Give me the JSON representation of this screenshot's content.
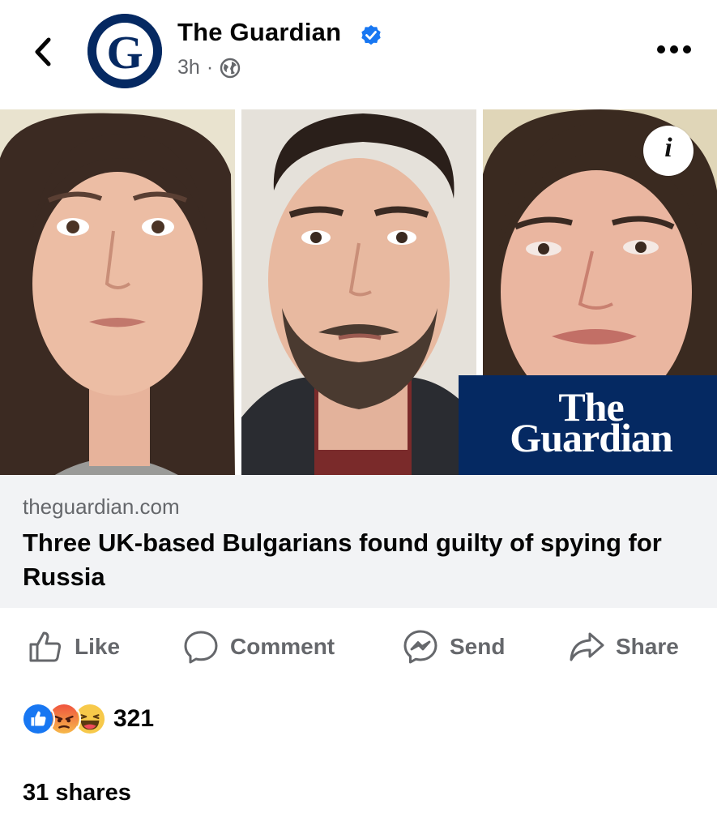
{
  "post": {
    "page_name": "The Guardian",
    "time": "3h",
    "separator": "·"
  },
  "photos": {
    "brand_line1": "The",
    "brand_line2": "Guardian",
    "info_glyph": "i"
  },
  "link": {
    "domain": "theguardian.com",
    "headline": "Three UK-based Bulgarians found guilty of spying for Russia"
  },
  "actions": {
    "like": "Like",
    "comment": "Comment",
    "send": "Send",
    "share": "Share"
  },
  "engagement": {
    "reaction_count": "321",
    "shares": "31 shares"
  },
  "icons": [
    "back-chevron-icon",
    "guardian-logo",
    "verified-badge-icon",
    "globe-icon",
    "more-options-icon",
    "info-icon",
    "like-icon",
    "comment-icon",
    "messenger-icon",
    "share-icon",
    "like-reaction-icon",
    "angry-reaction-icon",
    "haha-reaction-icon"
  ],
  "colors": {
    "guardian_blue": "#052962",
    "verified_blue": "#1877f2",
    "secondary_text": "#65676b",
    "link_bg": "#f2f3f5"
  }
}
